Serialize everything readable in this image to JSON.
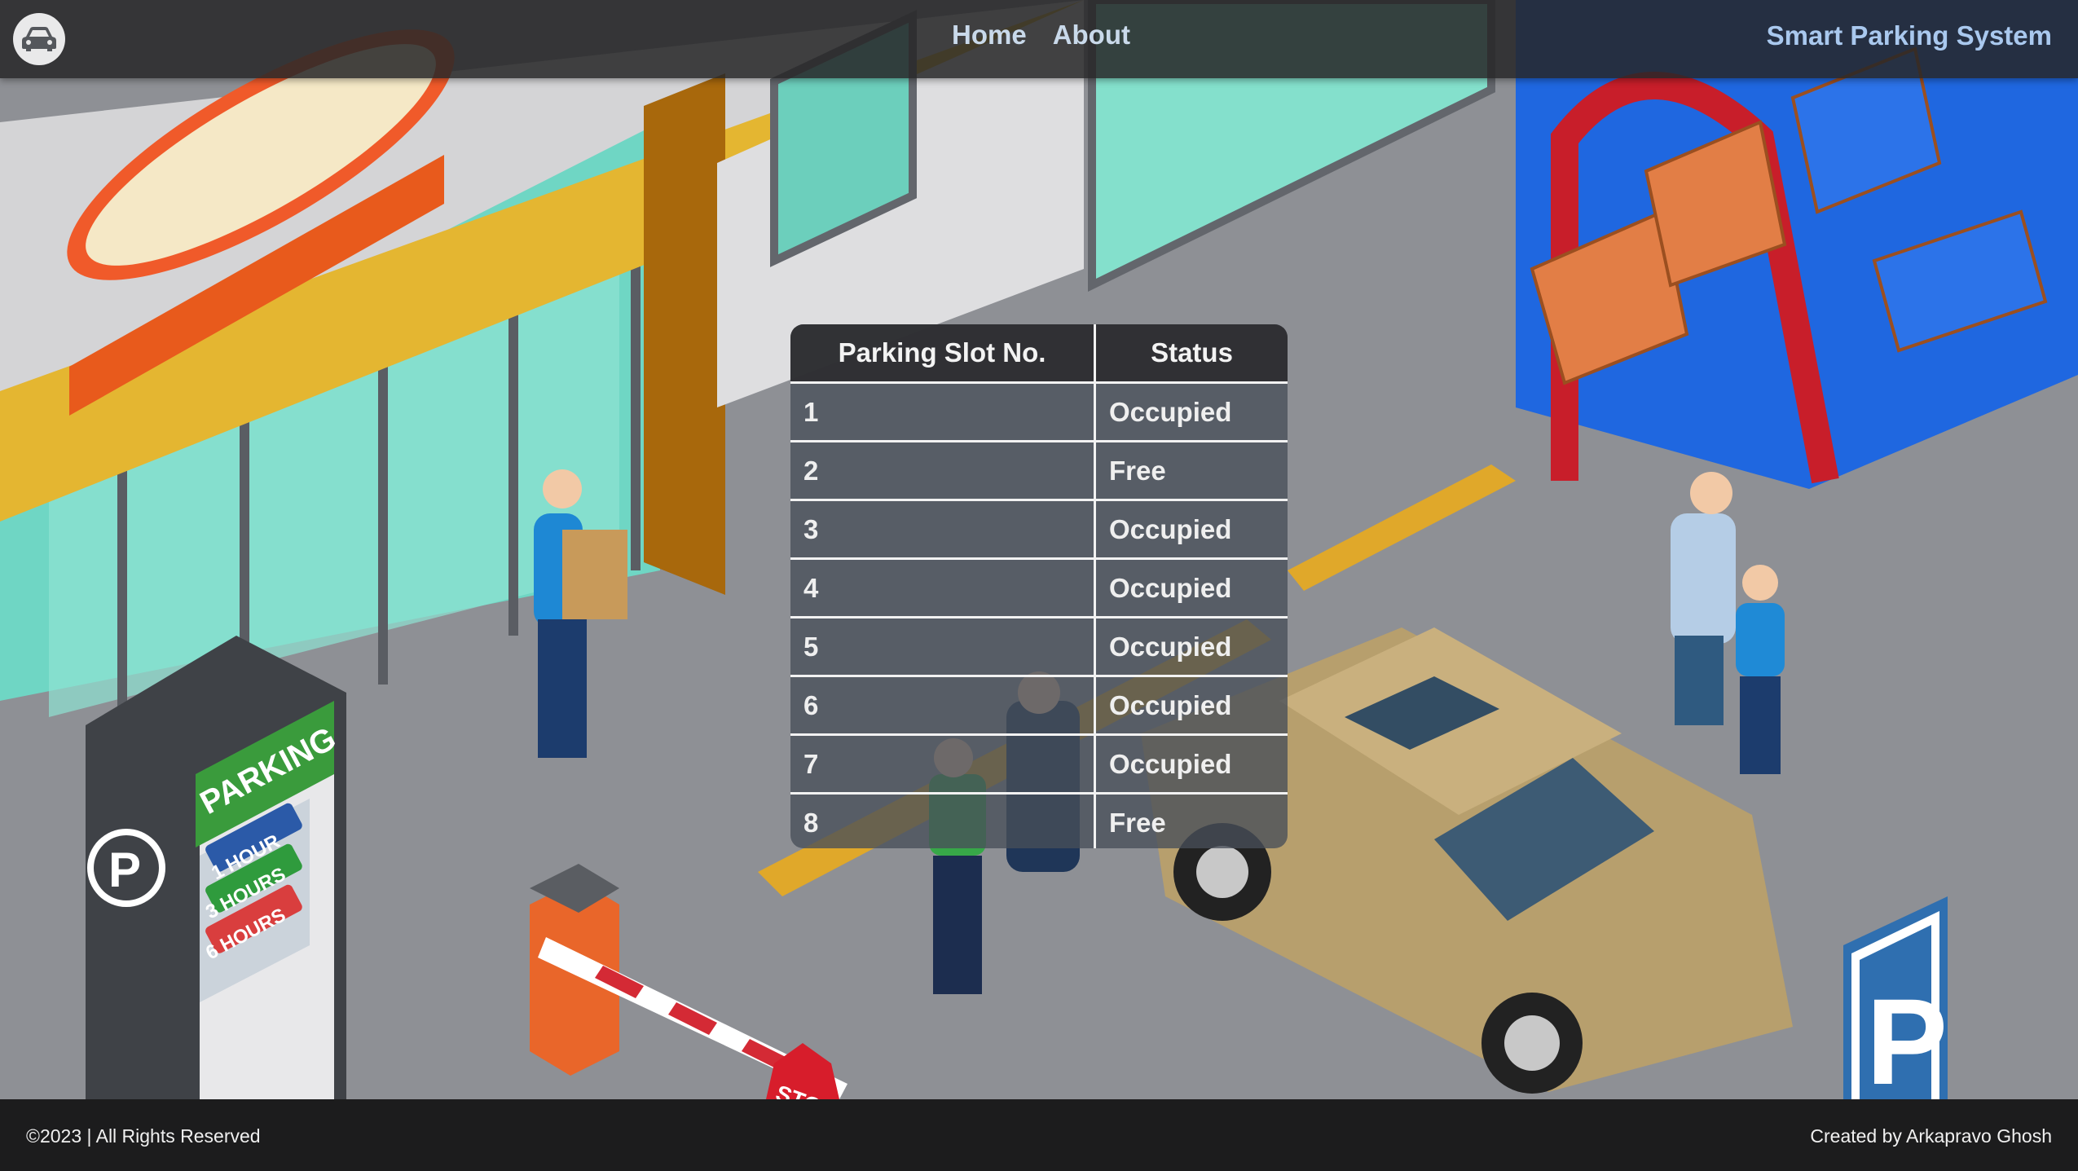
{
  "navbar": {
    "links": [
      "Home",
      "About"
    ],
    "brand": "Smart Parking System",
    "logo_icon": "car-icon"
  },
  "parking_table": {
    "headers": [
      "Parking Slot No.",
      "Status"
    ],
    "rows": [
      {
        "slot": "1",
        "status": "Occupied"
      },
      {
        "slot": "2",
        "status": "Free"
      },
      {
        "slot": "3",
        "status": "Occupied"
      },
      {
        "slot": "4",
        "status": "Occupied"
      },
      {
        "slot": "5",
        "status": "Occupied"
      },
      {
        "slot": "6",
        "status": "Occupied"
      },
      {
        "slot": "7",
        "status": "Occupied"
      },
      {
        "slot": "8",
        "status": "Free"
      }
    ]
  },
  "footer": {
    "copyright": "©2023 | All Rights Reserved",
    "credit": "Created by Arkapravo Ghosh"
  },
  "background": {
    "parking_sign_letter": "P",
    "stop_sign_text": "STOP",
    "meter_sign_text": "PARKING",
    "meter_options": [
      "1 HOUR",
      "3 HOURS",
      "6 HOURS"
    ]
  }
}
